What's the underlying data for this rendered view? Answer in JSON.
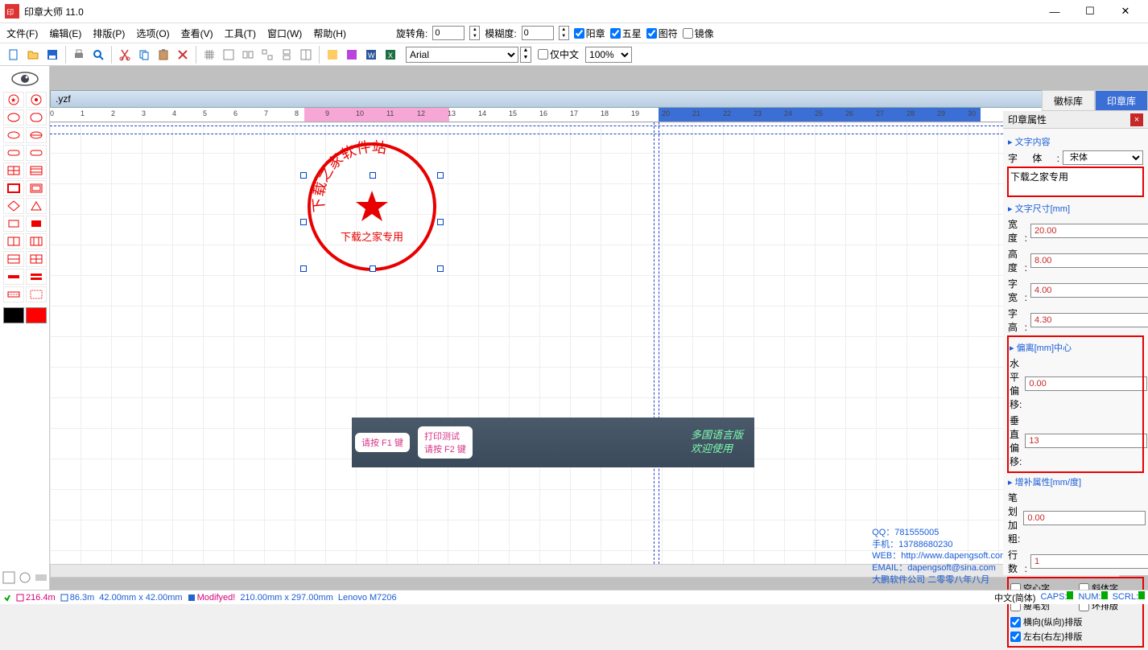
{
  "app": {
    "title": "印章大师 11.0"
  },
  "menu": {
    "file": "文件(F)",
    "edit": "编辑(E)",
    "layout": "排版(P)",
    "options": "选项(O)",
    "view": "查看(V)",
    "tools": "工具(T)",
    "window": "窗口(W)",
    "help": "帮助(H)",
    "rot_label": "旋转角:",
    "blur_label": "模糊度:",
    "rot_val": "0",
    "blur_val": "0",
    "ck_yang": "阳章",
    "ck_star": "五星",
    "ck_tufu": "图符",
    "ck_mirror": "镜像"
  },
  "toolbar": {
    "font": "Arial",
    "only_cn": "仅中文",
    "zoom": "100%"
  },
  "doc": {
    "filename": ".yzf"
  },
  "seal": {
    "arc_text": "下载之家软件站",
    "bottom_text": "下载之家专用"
  },
  "banner": {
    "c1a": "请按 F1 键",
    "c2a": "打印测试",
    "c2b": "请按 F2 键",
    "g1": "多国语言版",
    "g2": "欢迎使用"
  },
  "contact": {
    "qq": "QQ：781555005",
    "tel": "手机：13788680230",
    "web": "WEB：http://www.dapengsoft.com.cn",
    "email": "EMAIL：dapengsoft@sina.com",
    "co": "大鹏软件公司 二零零八年八月"
  },
  "tabs": {
    "badge": "徽标库",
    "seal": "印章库"
  },
  "props": {
    "title": "印章属性",
    "sec_text": "文字内容",
    "font_lbl": "字体:",
    "font_val": "宋体",
    "text_val": "下载之家专用",
    "sec_size": "文字尺寸[mm]",
    "w_lbl": "宽　度:",
    "w_val": "20.00",
    "h_lbl": "高　度:",
    "h_val": "8.00",
    "cw_lbl": "字　宽:",
    "cw_val": "4.00",
    "ch_lbl": "字　高:",
    "ch_val": "4.30",
    "sec_off": "偏离[mm]中心",
    "ox_lbl": "水平偏移:",
    "ox_val": "0.00",
    "oy_lbl": "垂直偏移:",
    "oy_val": "13",
    "sec_ext": "增补属性[mm/度]",
    "bold_lbl": "笔划加粗:",
    "bold_val": "0.00",
    "rows_lbl": "行　数:",
    "rows_val": "1",
    "ck_hollow": "空心字",
    "ck_italic": "斜体字",
    "ck_thin": "瘦笔划",
    "ck_ring": "环排版",
    "ck_hv": "横向(纵向)排版",
    "ck_lr": "左右(右左)排版"
  },
  "status": {
    "x": "216.4m",
    "y": "86.3m",
    "size": "42.00mm x 42.00mm",
    "mod": "Modifyed!",
    "page": "210.00mm x 297.00mm",
    "printer": "Lenovo M7206",
    "lang": "中文(简体)",
    "caps": "CAPS:",
    "num": "NUM:",
    "scrl": "SCRL:"
  },
  "ruler": {
    "marks": [
      0,
      1,
      2,
      3,
      4,
      5,
      6,
      7,
      8,
      9,
      10,
      11,
      12,
      13,
      14,
      15,
      16,
      17,
      18,
      19,
      20,
      21,
      22,
      23,
      24,
      25,
      26,
      27,
      28,
      29,
      30
    ]
  }
}
